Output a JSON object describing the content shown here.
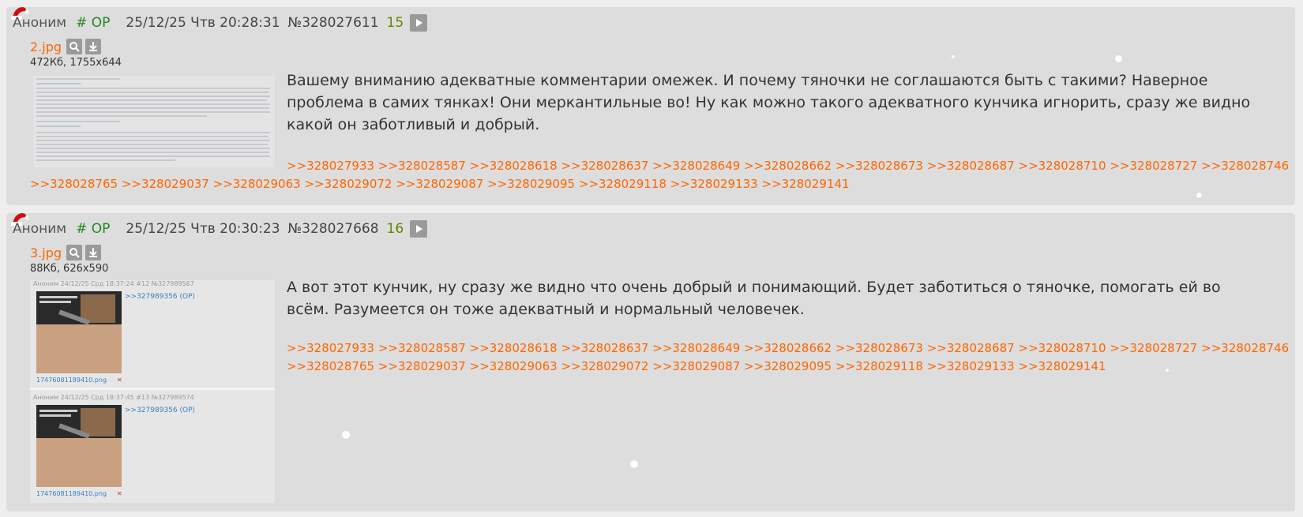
{
  "posts": [
    {
      "name": "Аноним",
      "trip": "# OP",
      "datetime": "25/12/25 Чтв 20:28:31",
      "number": "№328027611",
      "counter": "15",
      "file": {
        "name": "2.jpg",
        "meta": "472Кб, 1755x644"
      },
      "message": "Вашему вниманию адекватные комментарии омежек. И почему тяночки не соглашаются быть с такими? Наверное проблема в самих тянках! Они меркантильные во! Ну как можно такого адекватного кунчика игнорить, сразу же видно какой он заботливый и добрый.",
      "replies_line1": [
        ">>328027933",
        ">>328028587",
        ">>328028618",
        ">>328028637",
        ">>328028649",
        ">>328028662",
        ">>328028673",
        ">>328028687",
        ">>328028710",
        ">>328028727",
        ">>328028746"
      ],
      "replies_line2": [
        ">>328028765",
        ">>328029037",
        ">>328029063",
        ">>328029072",
        ">>328029087",
        ">>328029095",
        ">>328029118",
        ">>328029133",
        ">>328029141"
      ]
    },
    {
      "name": "Аноним",
      "trip": "# OP",
      "datetime": "25/12/25 Чтв 20:30:23",
      "number": "№328027668",
      "counter": "16",
      "file": {
        "name": "3.jpg",
        "meta": "88Кб, 626x590"
      },
      "message": "А вот этот кунчик, ну сразу же видно что очень добрый и понимающий. Будет заботиться о тяночке, помогать ей во всём. Разумеется он тоже адекватный и нормальный человечек.",
      "replies_line1": [
        ">>328027933",
        ">>328028587",
        ">>328028618",
        ">>328028637",
        ">>328028649",
        ">>328028662",
        ">>328028673",
        ">>328028687",
        ">>328028710",
        ">>328028727",
        ">>328028746"
      ],
      "replies_line2": [
        ">>328028765",
        ">>328029037",
        ">>328029063",
        ">>328029072",
        ">>328029087",
        ">>328029095",
        ">>328029118",
        ">>328029133",
        ">>328029141"
      ]
    }
  ],
  "thumbnail_2": {
    "cards": [
      {
        "header": "Аноним 24/12/25 Срд 18:37:24 #12 №327989567",
        "reply": ">>327989356 (OP)",
        "filename": "17476081189410.png"
      },
      {
        "header": "Аноним 24/12/25 Срд 18:37:45 #13 №327989574",
        "reply": ">>327989356 (OP)",
        "filename": "17476081189410.png"
      }
    ]
  },
  "colors": {
    "accent": "#ff6600",
    "trip": "#228822",
    "counter": "#5c8a00",
    "post_bg": "#dddddd",
    "page_bg": "#eeeeee"
  },
  "icons": {
    "hat": "santa-hat-icon",
    "play": "play-icon",
    "search": "search-icon",
    "download": "download-icon"
  }
}
